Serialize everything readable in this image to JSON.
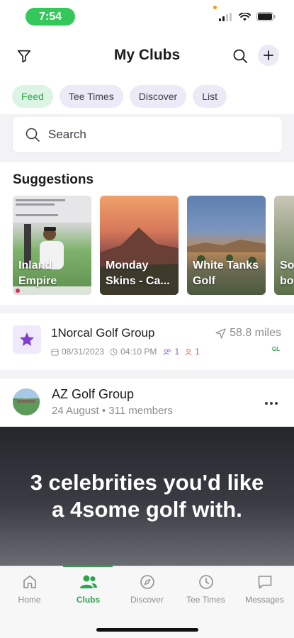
{
  "status_bar": {
    "time": "7:54"
  },
  "header": {
    "title": "My Clubs"
  },
  "chips": [
    "Feed",
    "Tee Times",
    "Discover",
    "List"
  ],
  "search": {
    "placeholder": "Search"
  },
  "suggestions": {
    "title": "Suggestions",
    "cards": [
      "Inland Empire",
      "Monday Skins - Ca...",
      "White Tanks Golf",
      "So bo"
    ]
  },
  "group": {
    "name": "1Norcal Golf Group",
    "date": "08/31/2023",
    "time": "04:10 PM",
    "members_count": "1",
    "requests_count": "1",
    "distance": "58.8 miles",
    "badge": "GL"
  },
  "post": {
    "group_name": "AZ Golf Group",
    "subtitle": "24 August • 311 members",
    "image_text": "3 celebrities you'd like a 4some golf with."
  },
  "tabs": [
    "Home",
    "Clubs",
    "Discover",
    "Tee Times",
    "Messages"
  ],
  "colors": {
    "accent": "#2ea44f",
    "chip_bg": "#ebeaf6",
    "purple": "#8a5ad6"
  },
  "icons": {
    "header": [
      "filter-icon",
      "search-icon",
      "plus-icon"
    ],
    "tabs": [
      "home-icon",
      "users-icon",
      "compass-icon",
      "clock-icon",
      "message-icon"
    ]
  }
}
